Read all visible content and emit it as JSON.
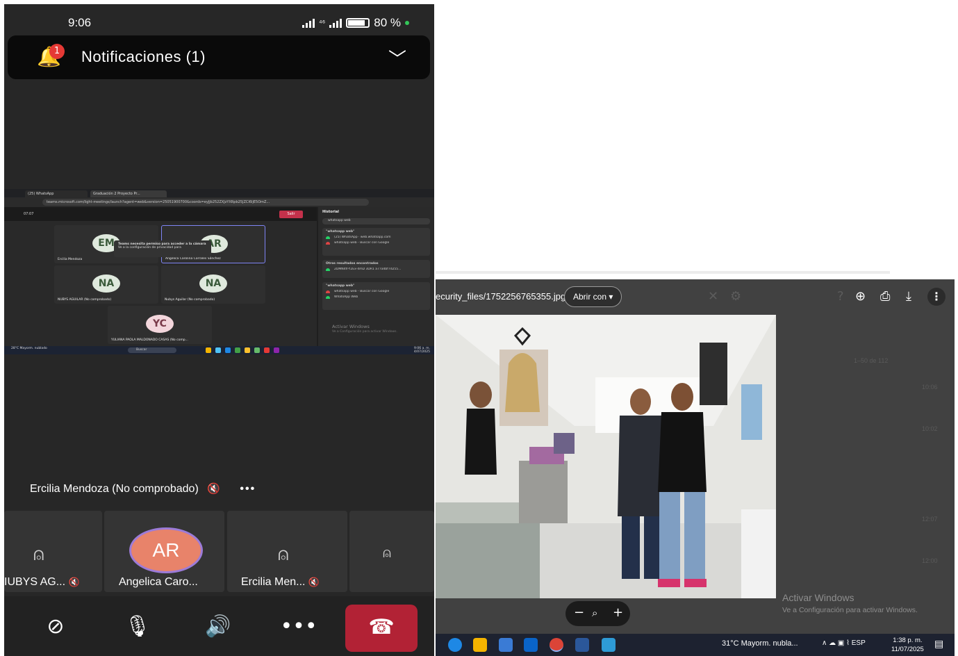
{
  "phone": {
    "status": {
      "time": "9:06",
      "network": "⁴⁶",
      "battery": "80 %"
    },
    "notification": {
      "badge": "1",
      "title": "Notificaciones (1)"
    },
    "shared_screen": {
      "tabs": [
        "(25) WhatsApp",
        "Graduación 2 Proyecto Pr..."
      ],
      "url": "teams.microsoft.com/light-meetings/launch?agent=web&version=25051900700&coords=eyJjb252ZXJzYXRpb25JZCI6IjE5OmZ...",
      "timer": "07:07",
      "leave": "Salir",
      "popup_title": "Teams necesita permiso para acceder a la cámara",
      "popup_body": "Ve a la configuración de privacidad para",
      "tiles": [
        {
          "initials": "EM",
          "name": "Ercilia Mendoza"
        },
        {
          "initials": "AR",
          "name": "Angelica Carolina Corrales Sánchez"
        },
        {
          "initials": "NA",
          "name": "NUBYS AGUILAR (No comprobado)"
        },
        {
          "initials": "NA",
          "name": "Nubys Aguilar (No comprobado)"
        },
        {
          "initials": "YC",
          "name": "YULIANA PAOLA MALDONADO CASAS (No comp..."
        }
      ],
      "history": {
        "title": "Historial",
        "search": "whatsapp web",
        "card1_head": "\"whatsapp web\"",
        "card1_rows": [
          "(25) WhatsApp · web.whatsapp.com",
          "whatsapp web - Buscar con Google"
        ],
        "card2_head": "Otros resultados encontrados",
        "card2_rows": [
          "2DMN4fr-Y2Ex-4mD 3DR1 a77a4bf7d255..."
        ],
        "card3_head": "\"whatsapp web\"",
        "card3_rows": [
          "whatsapp web - Buscar con Google",
          "WhatsApp Web"
        ],
        "activate": "Activar Windows",
        "activate_sub": "Ve a Configuración para activar Windows."
      },
      "taskbar": {
        "weather": "28°C Mayorm. nublado",
        "search": "Buscar",
        "time": "9:06 a. m.",
        "date": "4/07/2025"
      }
    },
    "speaker": {
      "name": "Ercilia Mendoza (No comprobado)",
      "more": "•••"
    },
    "participants": [
      {
        "name": "IUBYS AG...",
        "muted": true
      },
      {
        "name": "Angelica Caro...",
        "initials": "AR",
        "muted": false
      },
      {
        "name": "Ercilia Men...",
        "muted": true
      },
      {
        "name": "",
        "muted": false
      }
    ]
  },
  "viewer": {
    "filename": "ecurity_files/1752256765355.jpg",
    "open_with": "Abrir con",
    "activate": "Activar Windows",
    "activate_sub": "Ve a Configuración para activar Windows.",
    "taskbar": {
      "weather_temp": "31°C",
      "weather_text": "Mayorm. nubla...",
      "lang": "ESP",
      "time": "1:38 p. m.",
      "date": "11/07/2025"
    }
  },
  "colors": {
    "phone_bg": "#272727",
    "hangup": "#b22235",
    "avatar_ar": "#e8836a",
    "viewer_bg": "#414141",
    "taskbar": "#1d2230"
  }
}
